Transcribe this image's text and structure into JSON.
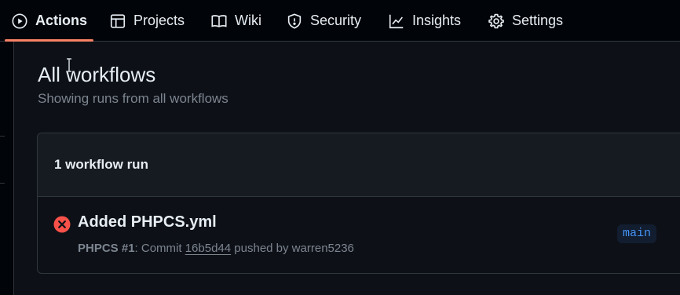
{
  "nav": {
    "tabs": [
      {
        "label": "Actions",
        "icon": "play-icon",
        "active": true
      },
      {
        "label": "Projects",
        "icon": "table-icon"
      },
      {
        "label": "Wiki",
        "icon": "book-icon"
      },
      {
        "label": "Security",
        "icon": "shield-icon"
      },
      {
        "label": "Insights",
        "icon": "graph-icon"
      },
      {
        "label": "Settings",
        "icon": "gear-icon"
      }
    ]
  },
  "main": {
    "title": "All workflows",
    "subtitle": "Showing runs from all workflows",
    "runs_count": "1 workflow run",
    "runs": [
      {
        "status": "failure",
        "title": "Added PHPCS.yml",
        "workflow": "PHPCS #1",
        "meta_prefix": ": Commit ",
        "sha": "16b5d44",
        "meta_suffix": " pushed by warren5236",
        "branch": "main"
      }
    ]
  },
  "colors": {
    "accent_underline": "#f78166",
    "failure": "#f85149",
    "branch_text": "#4493f8",
    "background": "#0d1117",
    "border": "#30363d"
  }
}
